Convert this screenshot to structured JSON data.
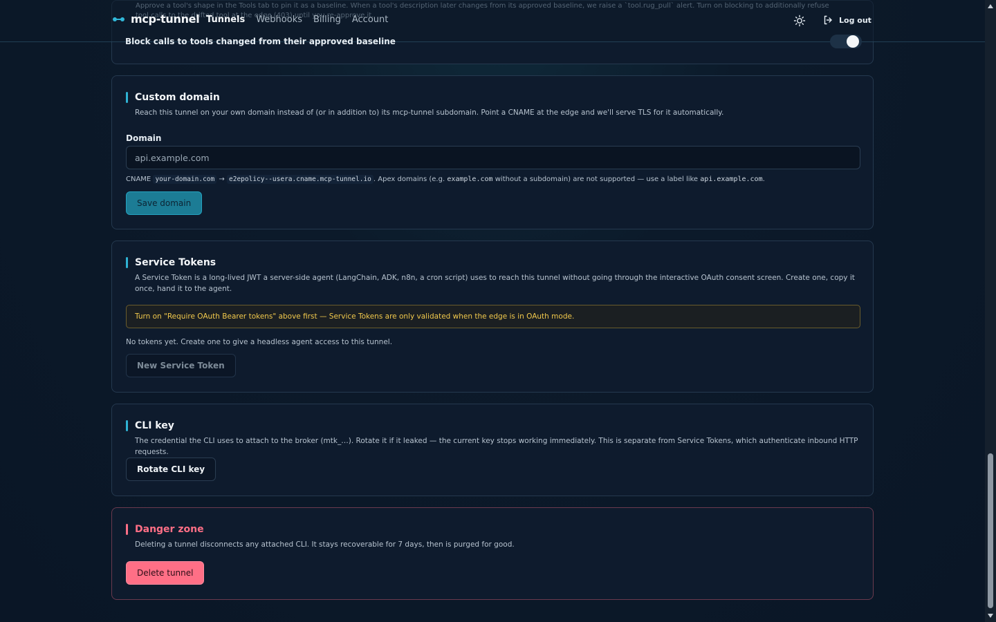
{
  "nav": {
    "brand": "mcp-tunnel",
    "links": [
      "Tunnels",
      "Webhooks",
      "Billing",
      "Account"
    ],
    "active_link": "Tunnels",
    "logout_label": "Log out",
    "ghost_line_1": "Approve a tool's shape in the Tools tab to pin it as a baseline. When a tool's description later changes from its approved baseline, we raise a `tool.rug_pull` alert. Turn on blocking to additionally refuse",
    "ghost_line_2": "tool calls to the drifted tool at the edge (403) until you re-approve it."
  },
  "previous_section": {
    "setting_title": "Block calls to tools changed from their approved baseline",
    "toggle_on": true
  },
  "custom_domain": {
    "title": "Custom domain",
    "description": "Reach this tunnel on your own domain instead of (or in addition to) its mcp-tunnel subdomain. Point a CNAME at the edge and we'll serve TLS for it automatically.",
    "field_label": "Domain",
    "placeholder": "api.example.com",
    "hint_prefix": "CNAME",
    "hint_code_1": "your-domain.com",
    "hint_arrow": "→",
    "hint_code_2": "e2epolicy--usera.cname.mcp-tunnel.io",
    "hint_text_1": ". Apex domains (e.g.",
    "hint_mono_1": "example.com",
    "hint_text_2": "without a subdomain) are not supported — use a label like",
    "hint_mono_2": "api.example.com",
    "hint_text_3": ".",
    "save_label": "Save domain"
  },
  "service_tokens": {
    "title": "Service Tokens",
    "description": "A Service Token is a long-lived JWT a server-side agent (LangChain, ADK, n8n, a cron script) uses to reach this tunnel without going through the interactive OAuth consent screen. Create one, copy it once, hand it to the agent.",
    "warning": "Turn on \"Require OAuth Bearer tokens\" above first — Service Tokens are only validated when the edge is in OAuth mode.",
    "empty_text": "No tokens yet. Create one to give a headless agent access to this tunnel.",
    "new_label": "New Service Token"
  },
  "cli_key": {
    "title": "CLI key",
    "description": "The credential the CLI uses to attach to the broker (mtk_…). Rotate it if it leaked — the current key stops working immediately. This is separate from Service Tokens, which authenticate inbound HTTP requests.",
    "rotate_label": "Rotate CLI key"
  },
  "danger_zone": {
    "title": "Danger zone",
    "description": "Deleting a tunnel disconnects any attached CLI. It stays recoverable for 7 days, then is purged for good.",
    "delete_label": "Delete tunnel"
  },
  "colors": {
    "accent": "#2fb3d4",
    "danger": "#ff6f86",
    "warning": "#f2c94c",
    "background": "#0c1a2a"
  }
}
